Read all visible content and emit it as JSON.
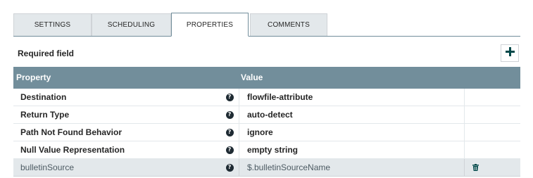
{
  "tabs": [
    {
      "label": "SETTINGS",
      "active": false
    },
    {
      "label": "SCHEDULING",
      "active": false
    },
    {
      "label": "PROPERTIES",
      "active": true
    },
    {
      "label": "COMMENTS",
      "active": false
    }
  ],
  "required_label": "Required field",
  "table": {
    "headers": {
      "property": "Property",
      "value": "Value"
    },
    "rows": [
      {
        "name": "Destination",
        "value": "flowfile-attribute",
        "required": true
      },
      {
        "name": "Return Type",
        "value": "auto-detect",
        "required": true
      },
      {
        "name": "Path Not Found Behavior",
        "value": "ignore",
        "required": true
      },
      {
        "name": "Null Value Representation",
        "value": "empty string",
        "required": true
      },
      {
        "name": "bulletinSource",
        "value": "$.bulletinSourceName",
        "required": false,
        "deletable": true
      }
    ]
  },
  "icons": {
    "add": "plus-icon",
    "help": "question-circle-icon",
    "delete": "trash-icon"
  },
  "colors": {
    "header_bg": "#728e9b",
    "tab_bg": "#e3e8eb",
    "dynamic_row_bg": "#e3e8eb"
  }
}
